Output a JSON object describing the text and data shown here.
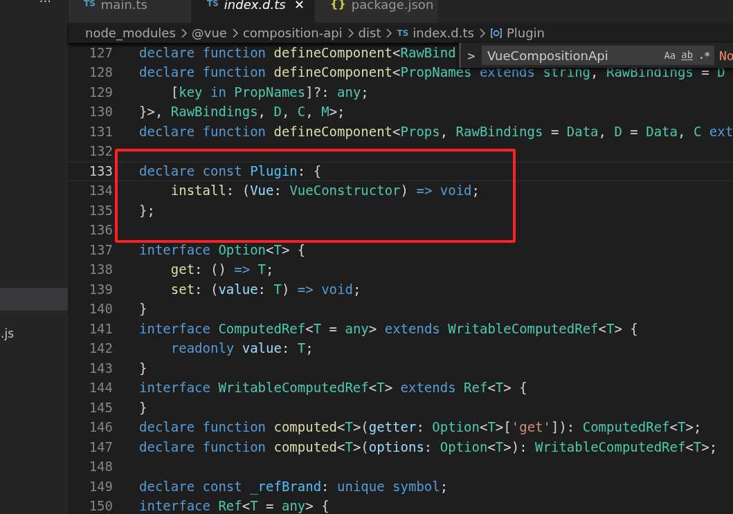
{
  "sidebar": {
    "more": "···",
    "items": [
      {
        "selected": true
      },
      {
        "label": ".js",
        "selected": false
      }
    ]
  },
  "tabs": [
    {
      "icon": "TS",
      "label": "main.ts",
      "selected": false,
      "preview": false
    },
    {
      "icon": "TS",
      "label": "index.d.ts",
      "selected": true,
      "preview": true,
      "close": "✕"
    },
    {
      "icon": "{}",
      "label": "package.json",
      "selected": false,
      "preview": false
    }
  ],
  "breadcrumb": [
    {
      "label": "node_modules",
      "kind": "folder"
    },
    {
      "label": "@vue",
      "kind": "folder"
    },
    {
      "label": "composition-api",
      "kind": "folder"
    },
    {
      "label": "dist",
      "kind": "folder"
    },
    {
      "label": "index.d.ts",
      "kind": "file",
      "icon": "TS"
    },
    {
      "label": "Plugin",
      "kind": "symbol"
    }
  ],
  "find": {
    "toggle": ">",
    "value": "VueCompositionApi",
    "options": [
      {
        "label": "Aa",
        "kind": "case"
      },
      {
        "label": "ab",
        "kind": "word"
      },
      {
        "label": ".*",
        "kind": "regex"
      }
    ],
    "result": "No"
  },
  "lines": [
    {
      "number": "127",
      "current": false,
      "tokens": [
        {
          "text": "declare ",
          "kind": "keyword"
        },
        {
          "text": "function ",
          "kind": "keyword"
        },
        {
          "text": "defineComponent",
          "kind": "function"
        },
        {
          "text": "<",
          "kind": "punct"
        },
        {
          "text": "RawBind",
          "kind": "type"
        }
      ]
    },
    {
      "number": "128",
      "current": false,
      "tokens": [
        {
          "text": "declare ",
          "kind": "keyword"
        },
        {
          "text": "function ",
          "kind": "keyword"
        },
        {
          "text": "defineComponent",
          "kind": "function"
        },
        {
          "text": "<",
          "kind": "punct"
        },
        {
          "text": "PropNames ",
          "kind": "type"
        },
        {
          "text": "extends ",
          "kind": "keyword"
        },
        {
          "text": "string",
          "kind": "type"
        },
        {
          "text": ", ",
          "kind": "punct"
        },
        {
          "text": "RawBindings",
          "kind": "type"
        },
        {
          "text": " = ",
          "kind": "punct"
        },
        {
          "text": "D",
          "kind": "type"
        }
      ]
    },
    {
      "number": "129",
      "current": false,
      "tokens": [
        {
          "text": "    [",
          "kind": "punct"
        },
        {
          "text": "key ",
          "kind": "type"
        },
        {
          "text": "in ",
          "kind": "keyword"
        },
        {
          "text": "PropNames",
          "kind": "type"
        },
        {
          "text": "]?: ",
          "kind": "punct"
        },
        {
          "text": "any",
          "kind": "type"
        },
        {
          "text": ";",
          "kind": "punct"
        }
      ]
    },
    {
      "number": "130",
      "current": false,
      "tokens": [
        {
          "text": "}>, ",
          "kind": "punct"
        },
        {
          "text": "RawBindings",
          "kind": "type"
        },
        {
          "text": ", ",
          "kind": "punct"
        },
        {
          "text": "D",
          "kind": "type"
        },
        {
          "text": ", ",
          "kind": "punct"
        },
        {
          "text": "C",
          "kind": "type"
        },
        {
          "text": ", ",
          "kind": "punct"
        },
        {
          "text": "M",
          "kind": "type"
        },
        {
          "text": ">;",
          "kind": "punct"
        }
      ]
    },
    {
      "number": "131",
      "current": false,
      "tokens": [
        {
          "text": "declare ",
          "kind": "keyword"
        },
        {
          "text": "function ",
          "kind": "keyword"
        },
        {
          "text": "defineComponent",
          "kind": "function"
        },
        {
          "text": "<",
          "kind": "punct"
        },
        {
          "text": "Props",
          "kind": "type"
        },
        {
          "text": ", ",
          "kind": "punct"
        },
        {
          "text": "RawBindings",
          "kind": "type"
        },
        {
          "text": " = ",
          "kind": "punct"
        },
        {
          "text": "Data",
          "kind": "type"
        },
        {
          "text": ", ",
          "kind": "punct"
        },
        {
          "text": "D",
          "kind": "type"
        },
        {
          "text": " = ",
          "kind": "punct"
        },
        {
          "text": "Data",
          "kind": "type"
        },
        {
          "text": ", ",
          "kind": "punct"
        },
        {
          "text": "C ",
          "kind": "type"
        },
        {
          "text": "ext",
          "kind": "keyword"
        }
      ]
    },
    {
      "number": "132",
      "current": false
    },
    {
      "number": "133",
      "current": true,
      "tokens": [
        {
          "text": "declare ",
          "kind": "keyword"
        },
        {
          "text": "const ",
          "kind": "keyword"
        },
        {
          "text": "Plugin",
          "kind": "constant"
        },
        {
          "text": ": {",
          "kind": "punct"
        }
      ]
    },
    {
      "number": "134",
      "current": false,
      "tokens": [
        {
          "text": "    install",
          "kind": "function"
        },
        {
          "text": ": (",
          "kind": "punct"
        },
        {
          "text": "Vue",
          "kind": "variable"
        },
        {
          "text": ": ",
          "kind": "punct"
        },
        {
          "text": "VueConstructor",
          "kind": "type"
        },
        {
          "text": ") ",
          "kind": "punct"
        },
        {
          "text": "=> ",
          "kind": "keyword"
        },
        {
          "text": "void",
          "kind": "keyword"
        },
        {
          "text": ";",
          "kind": "punct"
        }
      ]
    },
    {
      "number": "135",
      "current": false,
      "tokens": [
        {
          "text": "};",
          "kind": "punct"
        }
      ]
    },
    {
      "number": "136",
      "current": false
    },
    {
      "number": "137",
      "current": false,
      "tokens": [
        {
          "text": "interface ",
          "kind": "keyword"
        },
        {
          "text": "Option",
          "kind": "type"
        },
        {
          "text": "<",
          "kind": "punct"
        },
        {
          "text": "T",
          "kind": "type"
        },
        {
          "text": "> {",
          "kind": "punct"
        }
      ]
    },
    {
      "number": "138",
      "current": false,
      "tokens": [
        {
          "text": "    get",
          "kind": "function"
        },
        {
          "text": ": () ",
          "kind": "punct"
        },
        {
          "text": "=> ",
          "kind": "keyword"
        },
        {
          "text": "T",
          "kind": "type"
        },
        {
          "text": ";",
          "kind": "punct"
        }
      ]
    },
    {
      "number": "139",
      "current": false,
      "tokens": [
        {
          "text": "    set",
          "kind": "function"
        },
        {
          "text": ": (",
          "kind": "punct"
        },
        {
          "text": "value",
          "kind": "variable"
        },
        {
          "text": ": ",
          "kind": "punct"
        },
        {
          "text": "T",
          "kind": "type"
        },
        {
          "text": ") ",
          "kind": "punct"
        },
        {
          "text": "=> ",
          "kind": "keyword"
        },
        {
          "text": "void",
          "kind": "keyword"
        },
        {
          "text": ";",
          "kind": "punct"
        }
      ]
    },
    {
      "number": "140",
      "current": false,
      "tokens": [
        {
          "text": "}",
          "kind": "punct"
        }
      ]
    },
    {
      "number": "141",
      "current": false,
      "tokens": [
        {
          "text": "interface ",
          "kind": "keyword"
        },
        {
          "text": "ComputedRef",
          "kind": "type"
        },
        {
          "text": "<",
          "kind": "punct"
        },
        {
          "text": "T",
          "kind": "type"
        },
        {
          "text": " = ",
          "kind": "punct"
        },
        {
          "text": "any",
          "kind": "type"
        },
        {
          "text": "> ",
          "kind": "punct"
        },
        {
          "text": "extends ",
          "kind": "keyword"
        },
        {
          "text": "WritableComputedRef",
          "kind": "type"
        },
        {
          "text": "<",
          "kind": "punct"
        },
        {
          "text": "T",
          "kind": "type"
        },
        {
          "text": "> {",
          "kind": "punct"
        }
      ]
    },
    {
      "number": "142",
      "current": false,
      "tokens": [
        {
          "text": "    readonly ",
          "kind": "keyword"
        },
        {
          "text": "value",
          "kind": "variable"
        },
        {
          "text": ": ",
          "kind": "punct"
        },
        {
          "text": "T",
          "kind": "type"
        },
        {
          "text": ";",
          "kind": "punct"
        }
      ]
    },
    {
      "number": "143",
      "current": false,
      "tokens": [
        {
          "text": "}",
          "kind": "punct"
        }
      ]
    },
    {
      "number": "144",
      "current": false,
      "tokens": [
        {
          "text": "interface ",
          "kind": "keyword"
        },
        {
          "text": "WritableComputedRef",
          "kind": "type"
        },
        {
          "text": "<",
          "kind": "punct"
        },
        {
          "text": "T",
          "kind": "type"
        },
        {
          "text": "> ",
          "kind": "punct"
        },
        {
          "text": "extends ",
          "kind": "keyword"
        },
        {
          "text": "Ref",
          "kind": "type"
        },
        {
          "text": "<",
          "kind": "punct"
        },
        {
          "text": "T",
          "kind": "type"
        },
        {
          "text": "> {",
          "kind": "punct"
        }
      ]
    },
    {
      "number": "145",
      "current": false,
      "tokens": [
        {
          "text": "}",
          "kind": "punct"
        }
      ]
    },
    {
      "number": "146",
      "current": false,
      "tokens": [
        {
          "text": "declare ",
          "kind": "keyword"
        },
        {
          "text": "function ",
          "kind": "keyword"
        },
        {
          "text": "computed",
          "kind": "function"
        },
        {
          "text": "<",
          "kind": "punct"
        },
        {
          "text": "T",
          "kind": "type"
        },
        {
          "text": ">(",
          "kind": "punct"
        },
        {
          "text": "getter",
          "kind": "variable"
        },
        {
          "text": ": ",
          "kind": "punct"
        },
        {
          "text": "Option",
          "kind": "type"
        },
        {
          "text": "<",
          "kind": "punct"
        },
        {
          "text": "T",
          "kind": "type"
        },
        {
          "text": ">[",
          "kind": "punct"
        },
        {
          "text": "'get'",
          "kind": "string"
        },
        {
          "text": "]): ",
          "kind": "punct"
        },
        {
          "text": "ComputedRef",
          "kind": "type"
        },
        {
          "text": "<",
          "kind": "punct"
        },
        {
          "text": "T",
          "kind": "type"
        },
        {
          "text": ">;",
          "kind": "punct"
        }
      ]
    },
    {
      "number": "147",
      "current": false,
      "tokens": [
        {
          "text": "declare ",
          "kind": "keyword"
        },
        {
          "text": "function ",
          "kind": "keyword"
        },
        {
          "text": "computed",
          "kind": "function"
        },
        {
          "text": "<",
          "kind": "punct"
        },
        {
          "text": "T",
          "kind": "type"
        },
        {
          "text": ">(",
          "kind": "punct"
        },
        {
          "text": "options",
          "kind": "variable"
        },
        {
          "text": ": ",
          "kind": "punct"
        },
        {
          "text": "Option",
          "kind": "type"
        },
        {
          "text": "<",
          "kind": "punct"
        },
        {
          "text": "T",
          "kind": "type"
        },
        {
          "text": ">): ",
          "kind": "punct"
        },
        {
          "text": "WritableComputedRef",
          "kind": "type"
        },
        {
          "text": "<",
          "kind": "punct"
        },
        {
          "text": "T",
          "kind": "type"
        },
        {
          "text": ">;",
          "kind": "punct"
        }
      ]
    },
    {
      "number": "148",
      "current": false
    },
    {
      "number": "149",
      "current": false,
      "tokens": [
        {
          "text": "declare ",
          "kind": "keyword"
        },
        {
          "text": "const ",
          "kind": "keyword"
        },
        {
          "text": "_refBrand",
          "kind": "constant"
        },
        {
          "text": ": ",
          "kind": "punct"
        },
        {
          "text": "unique ",
          "kind": "keyword"
        },
        {
          "text": "symbol",
          "kind": "keyword"
        },
        {
          "text": ";",
          "kind": "punct"
        }
      ]
    },
    {
      "number": "150",
      "current": false,
      "tokens": [
        {
          "text": "interface ",
          "kind": "keyword"
        },
        {
          "text": "Ref",
          "kind": "type"
        },
        {
          "text": "<",
          "kind": "punct"
        },
        {
          "text": "T",
          "kind": "type"
        },
        {
          "text": " = ",
          "kind": "punct"
        },
        {
          "text": "any",
          "kind": "type"
        },
        {
          "text": "> {",
          "kind": "punct"
        }
      ]
    }
  ]
}
